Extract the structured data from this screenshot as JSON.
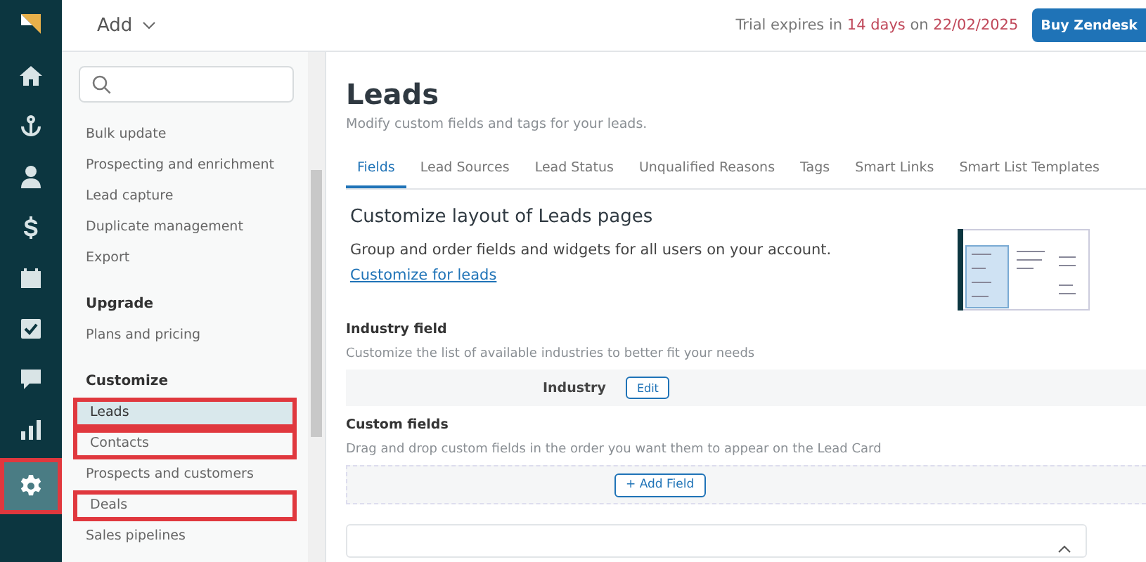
{
  "header": {
    "add_label": "Add",
    "trial": {
      "prefix": "Trial expires in ",
      "days": "14 days",
      "middle": " on ",
      "date": "22/02/2025"
    },
    "buy_button": "Buy Zendesk"
  },
  "rail": [
    {
      "kind": "home",
      "selected": false,
      "highlighted": false
    },
    {
      "kind": "anchor",
      "selected": false,
      "highlighted": false
    },
    {
      "kind": "person",
      "selected": false,
      "highlighted": false
    },
    {
      "kind": "dollar",
      "selected": false,
      "highlighted": false
    },
    {
      "kind": "calendar",
      "selected": false,
      "highlighted": false
    },
    {
      "kind": "task",
      "selected": false,
      "highlighted": false
    },
    {
      "kind": "chat",
      "selected": false,
      "highlighted": false
    },
    {
      "kind": "chart",
      "selected": false,
      "highlighted": false
    },
    {
      "kind": "gear",
      "selected": true,
      "highlighted": true
    }
  ],
  "sidebar": {
    "sections": [
      {
        "items": [
          {
            "label": "Bulk update",
            "selected": false,
            "highlighted": false
          },
          {
            "label": "Prospecting and enrichment",
            "selected": false,
            "highlighted": false
          },
          {
            "label": "Lead capture",
            "selected": false,
            "highlighted": false
          },
          {
            "label": "Duplicate management",
            "selected": false,
            "highlighted": false
          },
          {
            "label": "Export",
            "selected": false,
            "highlighted": false
          }
        ]
      },
      {
        "heading": "Upgrade",
        "items": [
          {
            "label": "Plans and pricing",
            "selected": false,
            "highlighted": false
          }
        ]
      },
      {
        "heading": "Customize",
        "items": [
          {
            "label": "Leads",
            "selected": true,
            "highlighted": true
          },
          {
            "label": "Contacts",
            "selected": false,
            "highlighted": true
          },
          {
            "label": "Prospects and customers",
            "selected": false,
            "highlighted": false
          },
          {
            "label": "Deals",
            "selected": false,
            "highlighted": true
          },
          {
            "label": "Sales pipelines",
            "selected": false,
            "highlighted": false
          }
        ]
      }
    ]
  },
  "page": {
    "title": "Leads",
    "subtitle": "Modify custom fields and tags for your leads.",
    "tabs": [
      {
        "label": "Fields",
        "selected": true
      },
      {
        "label": "Lead Sources",
        "selected": false
      },
      {
        "label": "Lead Status",
        "selected": false
      },
      {
        "label": "Unqualified Reasons",
        "selected": false
      },
      {
        "label": "Tags",
        "selected": false
      },
      {
        "label": "Smart Links",
        "selected": false
      },
      {
        "label": "Smart List Templates",
        "selected": false
      }
    ],
    "layout_card": {
      "title": "Customize layout of Leads pages",
      "text": "Group and order fields and widgets for all users on your account.",
      "link": "Customize for leads"
    },
    "industry": {
      "heading": "Industry field",
      "description": "Customize the list of available industries to better fit your needs",
      "field_label": "Industry",
      "edit_button": "Edit"
    },
    "custom": {
      "heading": "Custom fields",
      "description": "Drag and drop custom fields in the order you want them to appear on the Lead Card",
      "add_button": "+ Add Field"
    }
  }
}
